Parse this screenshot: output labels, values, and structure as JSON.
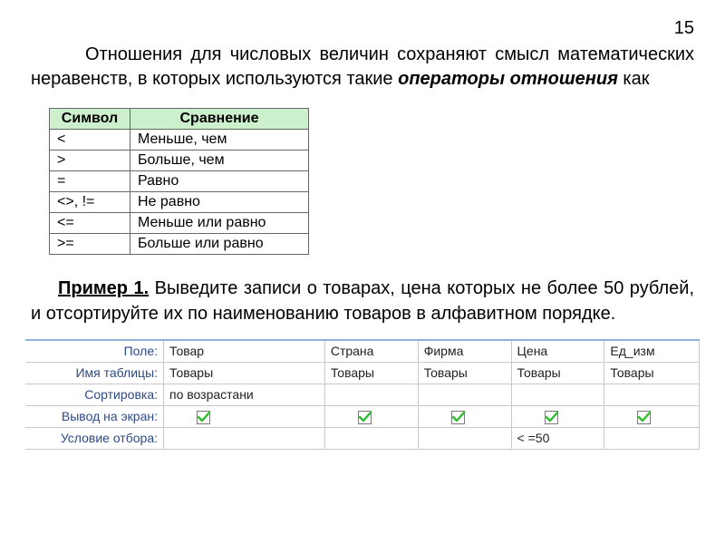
{
  "page_number": "15",
  "intro": {
    "p1": "Отношения для числовых величин сохраняют смысл математических неравенств, в которых используются такие ",
    "em": "операторы отношения",
    "p2": " как"
  },
  "operators_table": {
    "headers": {
      "symbol": "Символ",
      "comparison": "Сравнение"
    },
    "rows": [
      {
        "symbol": "<",
        "comparison": "Меньше, чем"
      },
      {
        "symbol": ">",
        "comparison": "Больше, чем"
      },
      {
        "symbol": "=",
        "comparison": "Равно"
      },
      {
        "symbol": "<>, !=",
        "comparison": "Не равно"
      },
      {
        "symbol": "<=",
        "comparison": "Меньше или равно"
      },
      {
        "symbol": ">=",
        "comparison": "Больше или равно"
      }
    ]
  },
  "example": {
    "label": "Пример 1.",
    "text": " Выведите записи о товарах, цена которых не более 50 рублей, и отсортируйте их по наименованию товаров в алфавитном порядке."
  },
  "query_grid": {
    "labels": {
      "field": "Поле:",
      "table": "Имя таблицы:",
      "sort": "Сортировка:",
      "show": "Вывод на экран:",
      "criteria": "Условие отбора:"
    },
    "columns": [
      {
        "field": "Товар",
        "table": "Товары",
        "sort": "по возрастани",
        "show": true,
        "criteria": ""
      },
      {
        "field": "Страна",
        "table": "Товары",
        "sort": "",
        "show": true,
        "criteria": ""
      },
      {
        "field": "Фирма",
        "table": "Товары",
        "sort": "",
        "show": true,
        "criteria": ""
      },
      {
        "field": "Цена",
        "table": "Товары",
        "sort": "",
        "show": true,
        "criteria": "< =50"
      },
      {
        "field": "Ед_изм",
        "table": "Товары",
        "sort": "",
        "show": true,
        "criteria": ""
      }
    ]
  }
}
